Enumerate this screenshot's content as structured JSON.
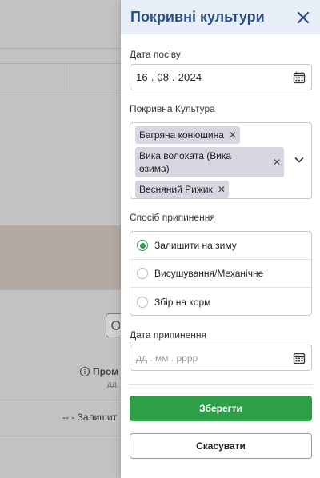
{
  "background": {
    "column_header": "Пром",
    "column_subheader": "дд.",
    "cell_text": "-- - Залишит"
  },
  "panel": {
    "title": "Покривні культури"
  },
  "sowing_date": {
    "label": "Дата посіву",
    "day": "16",
    "month": "08",
    "year": "2024",
    "separator": "."
  },
  "cover_crop": {
    "label": "Покривна Культура",
    "tags": [
      {
        "text": "Багряна конюшина"
      },
      {
        "text": "Вика волохата (Вика озима)"
      },
      {
        "text": "Весняний Рижик"
      }
    ]
  },
  "termination_method": {
    "label": "Спосіб припинення",
    "options": [
      {
        "label": "Залишити на зиму",
        "selected": true
      },
      {
        "label": "Висушування/Механічне",
        "selected": false
      },
      {
        "label": "Збір на корм",
        "selected": false
      }
    ]
  },
  "termination_date": {
    "label": "Дата припинення",
    "placeholder": "дд . мм . рррр"
  },
  "actions": {
    "save_label": "Зберегти",
    "cancel_label": "Скасувати"
  },
  "colors": {
    "title": "#2e4f86",
    "accent_green": "#2e9e47",
    "header_bg": "#e8eef6"
  }
}
